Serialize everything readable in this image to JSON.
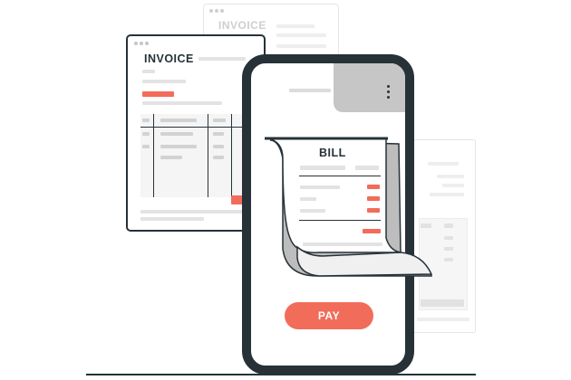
{
  "back_invoice": {
    "title": "INVOICE"
  },
  "front_invoice": {
    "title": "INVOICE"
  },
  "bill": {
    "title": "BILL"
  },
  "phone": {
    "pay_label": "PAY",
    "menu_icon": "kebab-menu-icon"
  },
  "colors": {
    "accent": "#f26c5a",
    "frame": "#263238",
    "paper": "#ffffff",
    "shade": "#bdbdbd"
  }
}
